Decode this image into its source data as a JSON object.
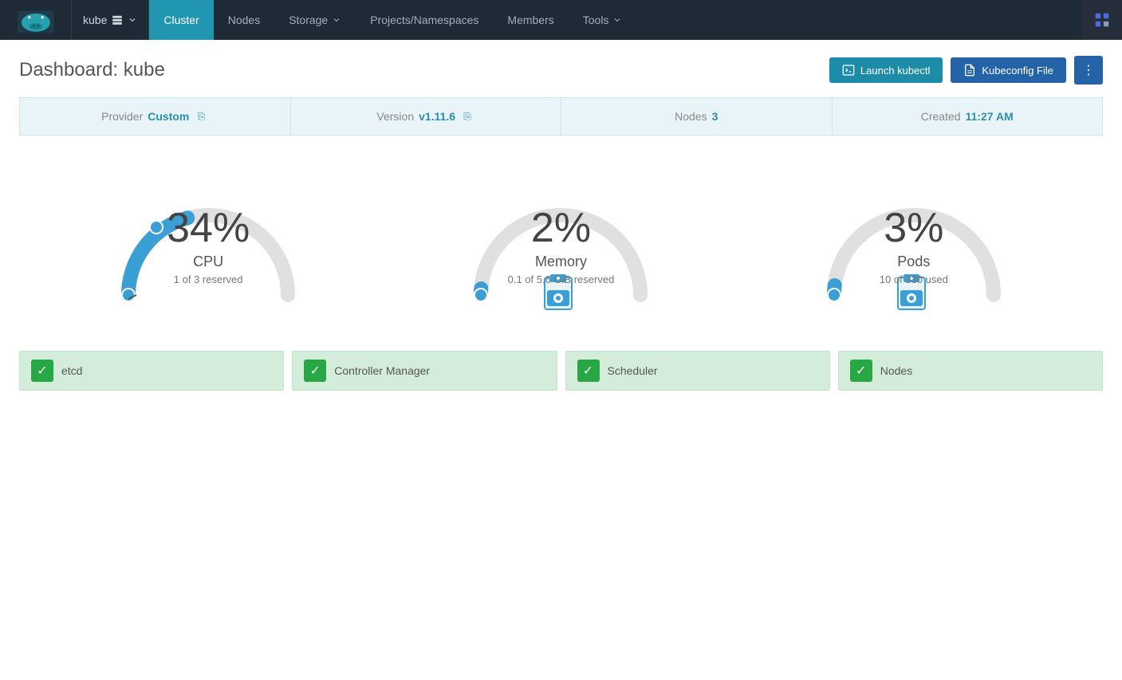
{
  "brand": {
    "name": "Rancher"
  },
  "navbar": {
    "cluster_name": "kube",
    "items": [
      {
        "label": "Cluster",
        "active": true
      },
      {
        "label": "Nodes",
        "active": false
      },
      {
        "label": "Storage",
        "active": false,
        "has_dropdown": true
      },
      {
        "label": "Projects/Namespaces",
        "active": false
      },
      {
        "label": "Members",
        "active": false
      },
      {
        "label": "Tools",
        "active": false,
        "has_dropdown": true
      }
    ]
  },
  "page": {
    "title": "Dashboard:",
    "cluster": "kube"
  },
  "actions": {
    "launch_kubectl": "Launch kubectl",
    "kubeconfig_file": "Kubeconfig File",
    "more": "⋮"
  },
  "info_bar": {
    "provider_label": "Provider",
    "provider_value": "Custom",
    "version_label": "Version",
    "version_value": "v1.11.6",
    "nodes_label": "Nodes",
    "nodes_value": "3",
    "created_label": "Created",
    "created_value": "11:27 AM"
  },
  "gauges": [
    {
      "id": "cpu",
      "percent": 34,
      "label": "CPU",
      "sub": "1 of 3 reserved",
      "color": "#3a9fd5",
      "track_color": "#e0e0e0"
    },
    {
      "id": "memory",
      "percent": 2,
      "label": "Memory",
      "sub": "0.1 of 5.6 GiB reserved",
      "color": "#3a9fd5",
      "track_color": "#e0e0e0"
    },
    {
      "id": "pods",
      "percent": 3,
      "label": "Pods",
      "sub": "10 of 330 used",
      "color": "#3a9fd5",
      "track_color": "#e0e0e0"
    }
  ],
  "status_items": [
    {
      "label": "etcd",
      "status": "ok"
    },
    {
      "label": "Controller Manager",
      "status": "ok"
    },
    {
      "label": "Scheduler",
      "status": "ok"
    },
    {
      "label": "Nodes",
      "status": "ok"
    }
  ]
}
